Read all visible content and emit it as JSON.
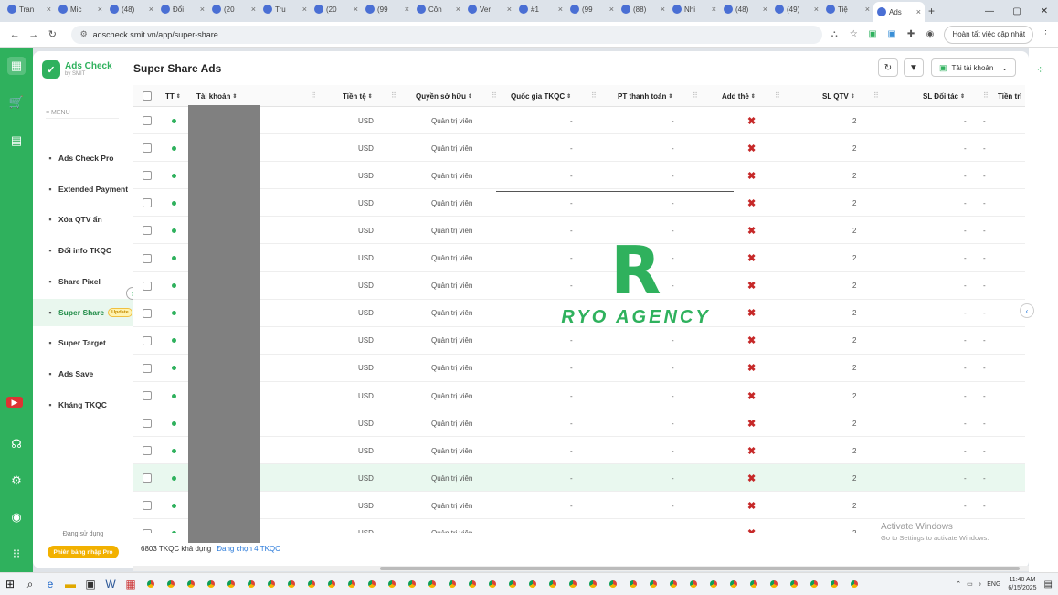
{
  "browser": {
    "tabs": [
      {
        "label": "Tran"
      },
      {
        "label": "Mic"
      },
      {
        "label": "(48)"
      },
      {
        "label": "Đổi"
      },
      {
        "label": "(20"
      },
      {
        "label": "Tru"
      },
      {
        "label": "(20"
      },
      {
        "label": "(99"
      },
      {
        "label": "Côn"
      },
      {
        "label": "Ver"
      },
      {
        "label": "#1"
      },
      {
        "label": "(99"
      },
      {
        "label": "(88)"
      },
      {
        "label": "Nhi"
      },
      {
        "label": "(48)"
      },
      {
        "label": "(49)"
      },
      {
        "label": "Tiệ"
      },
      {
        "label": "Ads",
        "active": true
      }
    ],
    "url": "adscheck.smit.vn/app/super-share",
    "update_button": "Hoàn tất việc cập nhật"
  },
  "sidebar": {
    "brand_name": "Ads Check",
    "brand_sub": "by SMIT",
    "menu_header": "≡ MENU",
    "items": [
      {
        "label": "Ads Check Pro",
        "icon": "chart-icon"
      },
      {
        "label": "Extended Payment",
        "icon": "card-icon"
      },
      {
        "label": "Xóa QTV ẩn",
        "icon": "user-remove-icon"
      },
      {
        "label": "Đổi info TKQC",
        "icon": "edit-icon"
      },
      {
        "label": "Share Pixel",
        "icon": "pixel-icon"
      },
      {
        "label": "Super Share",
        "icon": "share-icon",
        "active": true,
        "badge": "Update"
      },
      {
        "label": "Super Target",
        "icon": "target-icon"
      },
      {
        "label": "Ads Save",
        "icon": "save-icon"
      },
      {
        "label": "Kháng TKQC",
        "icon": "shield-icon"
      }
    ],
    "using_label": "Đang sử dụng",
    "upgrade_label": "Phiên bảng nhập Pro"
  },
  "main": {
    "title": "Super Share Ads",
    "download_label": "Tải tài khoản",
    "columns": [
      "TT",
      "Tài khoản",
      "Tiền tệ",
      "Quyền sở hữu",
      "Quốc gia TKQC",
      "PT thanh toán",
      "Add thẻ",
      "SL QTV",
      "SL Đối tác",
      "Tiền trì"
    ],
    "rows": [
      {
        "currency": "USD",
        "owner": "Quản trị viên",
        "country": "-",
        "payment": "-",
        "add_card": "✖",
        "sl_qtv": "2",
        "sl_partner": "-",
        "extra": "-"
      },
      {
        "currency": "USD",
        "owner": "Quản trị viên",
        "country": "-",
        "payment": "-",
        "add_card": "✖",
        "sl_qtv": "2",
        "sl_partner": "-",
        "extra": "-"
      },
      {
        "currency": "USD",
        "owner": "Quản trị viên",
        "country": "-",
        "payment": "-",
        "add_card": "✖",
        "sl_qtv": "2",
        "sl_partner": "-",
        "extra": "-"
      },
      {
        "currency": "USD",
        "owner": "Quản trị viên",
        "country": "-",
        "payment": "-",
        "add_card": "✖",
        "sl_qtv": "2",
        "sl_partner": "-",
        "extra": "-"
      },
      {
        "currency": "USD",
        "owner": "Quản trị viên",
        "country": "-",
        "payment": "-",
        "add_card": "✖",
        "sl_qtv": "2",
        "sl_partner": "-",
        "extra": "-"
      },
      {
        "currency": "USD",
        "owner": "Quản trị viên",
        "country": "-",
        "payment": "-",
        "add_card": "✖",
        "sl_qtv": "2",
        "sl_partner": "-",
        "extra": "-"
      },
      {
        "currency": "USD",
        "owner": "Quản trị viên",
        "country": "-",
        "payment": "-",
        "add_card": "✖",
        "sl_qtv": "2",
        "sl_partner": "-",
        "extra": "-"
      },
      {
        "currency": "USD",
        "owner": "Quản trị viên",
        "country": "-",
        "payment": "-",
        "add_card": "✖",
        "sl_qtv": "2",
        "sl_partner": "-",
        "extra": "-"
      },
      {
        "currency": "USD",
        "owner": "Quản trị viên",
        "country": "-",
        "payment": "-",
        "add_card": "✖",
        "sl_qtv": "2",
        "sl_partner": "-",
        "extra": "-"
      },
      {
        "currency": "USD",
        "owner": "Quản trị viên",
        "country": "-",
        "payment": "-",
        "add_card": "✖",
        "sl_qtv": "2",
        "sl_partner": "-",
        "extra": "-"
      },
      {
        "currency": "USD",
        "owner": "Quản trị viên",
        "country": "-",
        "payment": "-",
        "add_card": "✖",
        "sl_qtv": "2",
        "sl_partner": "-",
        "extra": "-"
      },
      {
        "currency": "USD",
        "owner": "Quản trị viên",
        "country": "-",
        "payment": "-",
        "add_card": "✖",
        "sl_qtv": "2",
        "sl_partner": "-",
        "extra": "-"
      },
      {
        "currency": "USD",
        "owner": "Quản trị viên",
        "country": "-",
        "payment": "-",
        "add_card": "✖",
        "sl_qtv": "2",
        "sl_partner": "-",
        "extra": "-"
      },
      {
        "currency": "USD",
        "owner": "Quản trị viên",
        "country": "-",
        "payment": "-",
        "add_card": "✖",
        "sl_qtv": "2",
        "sl_partner": "-",
        "extra": "-",
        "highlighted": true
      },
      {
        "currency": "USD",
        "owner": "Quản trị viên",
        "country": "-",
        "payment": "-",
        "add_card": "✖",
        "sl_qtv": "2",
        "sl_partner": "-",
        "extra": "-"
      },
      {
        "currency": "USD",
        "owner": "Quản trị viên",
        "country": "-",
        "payment": "-",
        "add_card": "✖",
        "sl_qtv": "2",
        "sl_partner": "-",
        "extra": "-"
      }
    ],
    "footer_count": "6803 TKQC khả dụng",
    "footer_selected": "Đang chọn 4 TKQC"
  },
  "watermark": {
    "brand": "RYO AGENCY",
    "letter": "R"
  },
  "windows_notice": {
    "title": "Activate Windows",
    "subtitle": "Go to Settings to activate Windows."
  },
  "taskbar": {
    "lang": "ENG",
    "time": "11:40 AM",
    "date": "6/15/2025"
  },
  "colors": {
    "accent": "#2fb15d",
    "danger": "#c62828",
    "link": "#2577d9"
  }
}
